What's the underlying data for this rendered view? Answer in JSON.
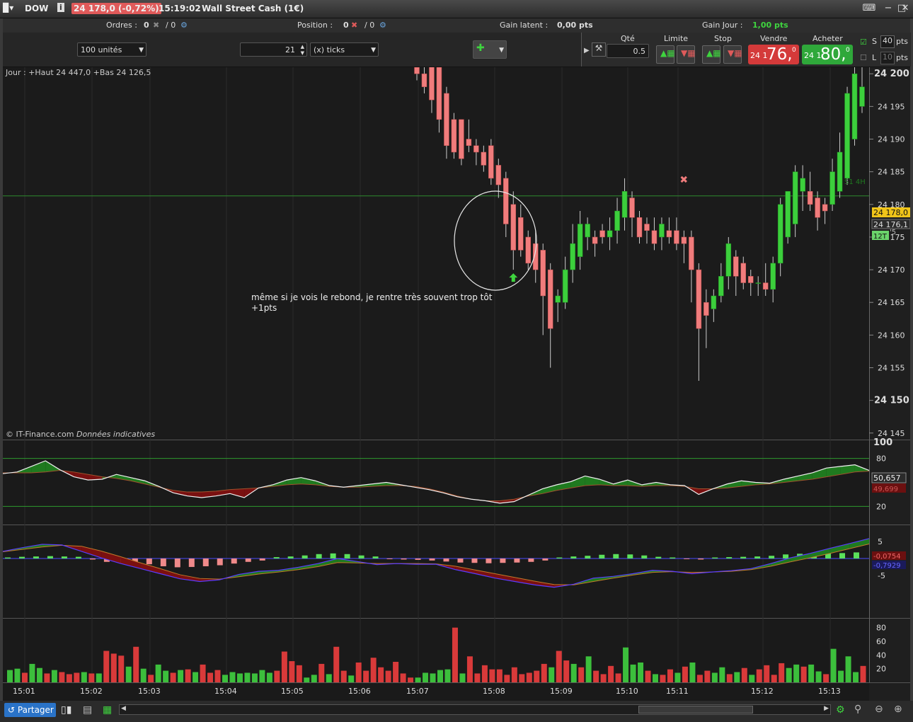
{
  "title_bar": {
    "symbol": "DOW",
    "change": "24 178,0 (-0,72%)",
    "time": "15:19:02",
    "instrument": "Wall Street Cash (1€)"
  },
  "stats": {
    "orders_label": "Ordres :",
    "orders_value": "0",
    "orders_sep": "/ 0",
    "position_label": "Position :",
    "position_value": "0",
    "position_sep": "/ 0",
    "latent_label": "Gain latent :",
    "latent_value": "0,00 pts",
    "day_label": "Gain Jour :",
    "day_value": "1,00 pts",
    "day_color": "#3fd43f"
  },
  "controls": {
    "units": "100 unités",
    "ticks_value": "21",
    "ticks_unit": "(x) ticks",
    "qty_label": "Qté",
    "qty_value": "0.5",
    "limit_label": "Limite",
    "stop_label": "Stop",
    "sell_label": "Vendre",
    "buy_label": "Acheter",
    "sell_quote_prefix": "24 1",
    "sell_quote_big": "76,",
    "sell_quote_sup": "0",
    "buy_quote_prefix": "24 1",
    "buy_quote_big": "80,",
    "buy_quote_sup": "0",
    "sell_color": "#d43a3a",
    "buy_color": "#2fa83a",
    "s_label": "S",
    "s_value": "40",
    "s_unit": "pts",
    "l_label": "L",
    "l_value": "10",
    "l_unit": "pts"
  },
  "chart_panel": {
    "info": "Jour : +Haut 24 447,0 +Bas 24 126,5",
    "watermark_prefix": "© IT-Finance.com",
    "watermark_italic": "Données indicatives",
    "annotation_line1": "même si je vois le rebond, je rentre très souvent trop tôt",
    "annotation_line2": "+1pts",
    "level_label": "S1 4H",
    "price_current": "24 178,0",
    "price_other": "24 176,1",
    "timer_label": "12T",
    "timer_extra": "'5"
  },
  "chart_data": [
    {
      "type": "candlestick",
      "y_axis": {
        "ticks": [
          "24 200",
          "24 195",
          "24 190",
          "24 185",
          "24 180",
          "24 175",
          "24 170",
          "24 165",
          "24 160",
          "24 155",
          "24 150",
          "24 145"
        ],
        "tick_values": [
          24200,
          24195,
          24190,
          24185,
          24180,
          24175,
          24170,
          24165,
          24160,
          24155,
          24150,
          24145
        ],
        "bold_ticks": [
          "24 200",
          "24 150"
        ],
        "range": [
          24144,
          24201
        ]
      },
      "x_axis": {
        "ticks": [
          "15:01",
          "15:02",
          "15:03",
          "15:04",
          "15:05",
          "15:06",
          "15:07",
          "15:08",
          "15:09",
          "15:10",
          "15:11",
          "15:12",
          "15:13"
        ]
      },
      "horizontal_level": 24181.3,
      "candles": [
        {
          "o": 24201,
          "h": 24202,
          "l": 24199,
          "c": 24200
        },
        {
          "o": 24200,
          "h": 24201,
          "l": 24197,
          "c": 24198
        },
        {
          "o": 24202,
          "h": 24203,
          "l": 24194,
          "c": 24196
        },
        {
          "o": 24201,
          "h": 24202,
          "l": 24191,
          "c": 24193
        },
        {
          "o": 24197,
          "h": 24198,
          "l": 24187,
          "c": 24189
        },
        {
          "o": 24193,
          "h": 24194,
          "l": 24187,
          "c": 24188
        },
        {
          "o": 24193,
          "h": 24193,
          "l": 24186,
          "c": 24187
        },
        {
          "o": 24190,
          "h": 24193,
          "l": 24188,
          "c": 24189
        },
        {
          "o": 24189,
          "h": 24190,
          "l": 24186,
          "c": 24188
        },
        {
          "o": 24188,
          "h": 24189,
          "l": 24185,
          "c": 24186
        },
        {
          "o": 24189,
          "h": 24190,
          "l": 24183,
          "c": 24184
        },
        {
          "o": 24186,
          "h": 24187,
          "l": 24181,
          "c": 24183
        },
        {
          "o": 24184,
          "h": 24185,
          "l": 24175,
          "c": 24177
        },
        {
          "o": 24180,
          "h": 24182,
          "l": 24170,
          "c": 24173
        },
        {
          "o": 24178,
          "h": 24180,
          "l": 24172,
          "c": 24173
        },
        {
          "o": 24175,
          "h": 24176,
          "l": 24170,
          "c": 24171
        },
        {
          "o": 24174,
          "h": 24176,
          "l": 24168,
          "c": 24170
        },
        {
          "o": 24173,
          "h": 24174,
          "l": 24160,
          "c": 24166
        },
        {
          "o": 24170,
          "h": 24171,
          "l": 24155,
          "c": 24161
        },
        {
          "o": 24165,
          "h": 24167,
          "l": 24162,
          "c": 24166
        },
        {
          "o": 24165,
          "h": 24172,
          "l": 24164,
          "c": 24170
        },
        {
          "o": 24170,
          "h": 24177,
          "l": 24168,
          "c": 24174
        },
        {
          "o": 24172,
          "h": 24179,
          "l": 24170,
          "c": 24177
        },
        {
          "o": 24175,
          "h": 24178,
          "l": 24173,
          "c": 24177
        },
        {
          "o": 24175,
          "h": 24176,
          "l": 24172,
          "c": 24174
        },
        {
          "o": 24176,
          "h": 24177,
          "l": 24174,
          "c": 24175
        },
        {
          "o": 24175,
          "h": 24178,
          "l": 24173,
          "c": 24176
        },
        {
          "o": 24176,
          "h": 24181,
          "l": 24174,
          "c": 24179
        },
        {
          "o": 24178,
          "h": 24184,
          "l": 24176,
          "c": 24182
        },
        {
          "o": 24181,
          "h": 24182,
          "l": 24175,
          "c": 24178
        },
        {
          "o": 24178,
          "h": 24179,
          "l": 24174,
          "c": 24175
        },
        {
          "o": 24177,
          "h": 24178,
          "l": 24174,
          "c": 24176
        },
        {
          "o": 24176,
          "h": 24178,
          "l": 24173,
          "c": 24174
        },
        {
          "o": 24175,
          "h": 24178,
          "l": 24173,
          "c": 24177
        },
        {
          "o": 24176,
          "h": 24178,
          "l": 24174,
          "c": 24175
        },
        {
          "o": 24176,
          "h": 24178,
          "l": 24173,
          "c": 24174
        },
        {
          "o": 24175,
          "h": 24176,
          "l": 24171,
          "c": 24174
        },
        {
          "o": 24175,
          "h": 24176,
          "l": 24165,
          "c": 24170
        },
        {
          "o": 24170,
          "h": 24171,
          "l": 24153,
          "c": 24161
        },
        {
          "o": 24165,
          "h": 24167,
          "l": 24158,
          "c": 24163
        },
        {
          "o": 24164,
          "h": 24167,
          "l": 24162,
          "c": 24166
        },
        {
          "o": 24166,
          "h": 24171,
          "l": 24165,
          "c": 24169
        },
        {
          "o": 24169,
          "h": 24175,
          "l": 24167,
          "c": 24174
        },
        {
          "o": 24172,
          "h": 24173,
          "l": 24166,
          "c": 24169
        },
        {
          "o": 24171,
          "h": 24172,
          "l": 24167,
          "c": 24168
        },
        {
          "o": 24169,
          "h": 24170,
          "l": 24166,
          "c": 24168
        },
        {
          "o": 24168,
          "h": 24169,
          "l": 24166,
          "c": 24168
        },
        {
          "o": 24168,
          "h": 24171,
          "l": 24166,
          "c": 24167
        },
        {
          "o": 24167,
          "h": 24172,
          "l": 24165,
          "c": 24171
        },
        {
          "o": 24171,
          "h": 24181,
          "l": 24169,
          "c": 24180
        },
        {
          "o": 24175,
          "h": 24182,
          "l": 24174,
          "c": 24182
        },
        {
          "o": 24177,
          "h": 24186,
          "l": 24175,
          "c": 24185
        },
        {
          "o": 24182,
          "h": 24186,
          "l": 24179,
          "c": 24184
        },
        {
          "o": 24182,
          "h": 24185,
          "l": 24179,
          "c": 24180
        },
        {
          "o": 24181,
          "h": 24182,
          "l": 24176,
          "c": 24178
        },
        {
          "o": 24180,
          "h": 24181,
          "l": 24177,
          "c": 24179
        },
        {
          "o": 24180,
          "h": 24187,
          "l": 24179,
          "c": 24185
        },
        {
          "o": 24182,
          "h": 24191,
          "l": 24181,
          "c": 24188
        },
        {
          "o": 24184,
          "h": 24198,
          "l": 24183,
          "c": 24197
        },
        {
          "o": 24190,
          "h": 24201,
          "l": 24189,
          "c": 24200
        },
        {
          "o": 24195,
          "h": 24201,
          "l": 24194,
          "c": 24198
        }
      ],
      "markers": [
        {
          "type": "buy-arrow",
          "candle": 13,
          "price": 24168.8
        },
        {
          "type": "exit-cross",
          "candle": 36,
          "price": 24183.8
        }
      ]
    },
    {
      "type": "line",
      "name": "oscillator",
      "y_axis": {
        "ticks": [
          "100",
          "80",
          "20"
        ],
        "tick_values": [
          100,
          80,
          20
        ],
        "range": [
          0,
          100
        ]
      },
      "levels": [
        80,
        20
      ],
      "values": [
        61,
        63,
        70,
        77,
        66,
        57,
        53,
        54,
        60,
        56,
        52,
        45,
        37,
        33,
        31,
        33,
        36,
        31,
        43,
        47,
        53,
        56,
        52,
        46,
        44,
        46,
        48,
        50,
        47,
        44,
        41,
        37,
        32,
        29,
        27,
        24,
        26,
        34,
        42,
        47,
        51,
        58,
        54,
        48,
        53,
        47,
        50,
        47,
        46,
        35,
        42,
        48,
        52,
        50,
        49,
        54,
        58,
        62,
        68,
        70,
        72,
        65
      ],
      "signal": [
        62,
        62,
        62,
        63,
        65,
        63,
        60,
        57,
        55,
        52,
        48,
        44,
        40,
        38,
        38,
        39,
        41,
        42,
        43,
        45,
        47,
        48,
        47,
        45,
        44,
        44,
        45,
        46,
        46,
        45,
        42,
        38,
        33,
        29,
        27,
        27,
        29,
        33,
        36,
        40,
        43,
        46,
        47,
        46,
        46,
        45,
        46,
        46,
        45,
        42,
        42,
        43,
        45,
        47,
        48,
        50,
        52,
        54,
        57,
        60,
        63,
        64
      ],
      "readout": "50,657",
      "readout2": "49,699"
    },
    {
      "type": "bar",
      "name": "histogram",
      "y_axis": {
        "ticks": [
          "5",
          "-5"
        ],
        "tick_values": [
          5,
          -5
        ],
        "range": [
          -9,
          9
        ]
      },
      "values": [
        0.3,
        0.5,
        0.6,
        0.7,
        0.6,
        0.5,
        -0.3,
        -1.0,
        -1.3,
        -1.5,
        -1.7,
        -2.3,
        -2.6,
        -2.5,
        -2.3,
        -2.0,
        -1.5,
        -1.0,
        -0.6,
        0.4,
        0.6,
        0.9,
        1.3,
        1.5,
        1.3,
        0.9,
        0.6,
        -0.2,
        -0.3,
        -0.4,
        -0.6,
        -0.9,
        -1.2,
        -1.3,
        -1.4,
        -1.3,
        -1.2,
        -1.0,
        -0.6,
        0.3,
        0.6,
        0.8,
        1.1,
        1.3,
        1.2,
        0.9,
        0.5,
        0.3,
        -0.2,
        -0.3,
        0.3,
        0.4,
        0.5,
        0.6,
        0.8,
        1.2,
        1.4,
        1.5,
        1.5,
        1.6,
        1.8
      ],
      "macd": [
        2.1,
        3.2,
        4.2,
        4.0,
        2.1,
        0.2,
        -1.5,
        -3.0,
        -4.5,
        -6.0,
        -6.8,
        -6.3,
        -4.7,
        -3.8,
        -3.5,
        -2.6,
        -1.5,
        0.0,
        -0.9,
        -1.8,
        -1.5,
        -1.7,
        -1.7,
        -3.3,
        -4.5,
        -5.8,
        -6.8,
        -7.8,
        -8.5,
        -7.6,
        -5.8,
        -5.3,
        -4.5,
        -3.5,
        -3.8,
        -4.5,
        -4.0,
        -3.6,
        -3.0,
        -1.5,
        0.2,
        1.5,
        3.0,
        4.4,
        5.9
      ],
      "signal": [
        2.0,
        2.7,
        3.4,
        3.9,
        3.6,
        2.2,
        0.5,
        -1.3,
        -3.0,
        -4.8,
        -5.9,
        -6.1,
        -5.4,
        -4.6,
        -4.0,
        -3.3,
        -2.4,
        -1.2,
        -1.3,
        -1.5,
        -1.5,
        -1.5,
        -1.6,
        -2.3,
        -3.4,
        -4.5,
        -5.6,
        -6.7,
        -7.7,
        -7.8,
        -6.8,
        -5.8,
        -4.9,
        -4.1,
        -3.9,
        -4.1,
        -4.0,
        -3.8,
        -3.3,
        -2.3,
        -1.0,
        0.2,
        1.5,
        2.9,
        4.3
      ],
      "readout": "-0,0754",
      "readout2": "-0,7929"
    },
    {
      "type": "bar",
      "name": "volume",
      "y_axis": {
        "ticks": [
          "80",
          "60",
          "40",
          "20"
        ],
        "tick_values": [
          80,
          60,
          40,
          20
        ],
        "range": [
          0,
          90
        ]
      },
      "values": [
        18,
        20,
        14,
        27,
        21,
        13,
        18,
        15,
        12,
        14,
        15,
        13,
        13,
        46,
        42,
        39,
        23,
        52,
        20,
        11,
        26,
        17,
        14,
        18,
        19,
        15,
        26,
        14,
        18,
        11,
        15,
        13,
        14,
        13,
        18,
        14,
        17,
        45,
        31,
        25,
        7,
        11,
        27,
        12,
        52,
        17,
        10,
        29,
        17,
        36,
        22,
        17,
        30,
        13,
        7,
        7,
        14,
        13,
        18,
        19,
        80,
        13,
        38,
        13,
        25,
        19,
        19,
        11,
        22,
        12,
        14,
        17,
        27,
        22,
        46,
        32,
        27,
        22,
        38,
        17,
        12,
        24,
        13,
        51,
        26,
        29,
        17,
        12,
        11,
        19,
        14,
        23,
        29,
        11,
        17,
        14,
        22,
        12,
        15,
        21,
        11,
        19,
        25,
        11,
        28,
        21,
        26,
        23,
        26,
        16,
        12,
        49,
        17,
        38,
        15,
        24
      ],
      "colors": [
        "g",
        "g",
        "r",
        "g",
        "g",
        "r",
        "g",
        "r",
        "r",
        "r",
        "g",
        "r",
        "g",
        "r",
        "r",
        "r",
        "g",
        "r",
        "g",
        "r",
        "g",
        "g",
        "r",
        "g",
        "r",
        "g",
        "r",
        "r",
        "r",
        "g",
        "g",
        "g",
        "g",
        "g",
        "g",
        "g",
        "r",
        "r",
        "r",
        "r",
        "g",
        "g",
        "r",
        "g",
        "r",
        "r",
        "g",
        "r",
        "r",
        "r",
        "r",
        "r",
        "r",
        "r",
        "r",
        "g",
        "g",
        "g",
        "g",
        "g",
        "r",
        "g",
        "r",
        "r",
        "r",
        "r",
        "r",
        "r",
        "r",
        "r",
        "r",
        "r",
        "r",
        "g",
        "r",
        "r",
        "g",
        "r",
        "g",
        "r",
        "r",
        "r",
        "r",
        "g",
        "g",
        "g",
        "r",
        "g",
        "r",
        "r",
        "g",
        "r",
        "g",
        "r",
        "r",
        "g",
        "g",
        "r",
        "g",
        "r",
        "g",
        "r",
        "r",
        "r",
        "r",
        "g",
        "g",
        "r",
        "g",
        "g",
        "r",
        "g",
        "g",
        "g",
        "g",
        "r"
      ]
    }
  ]
}
